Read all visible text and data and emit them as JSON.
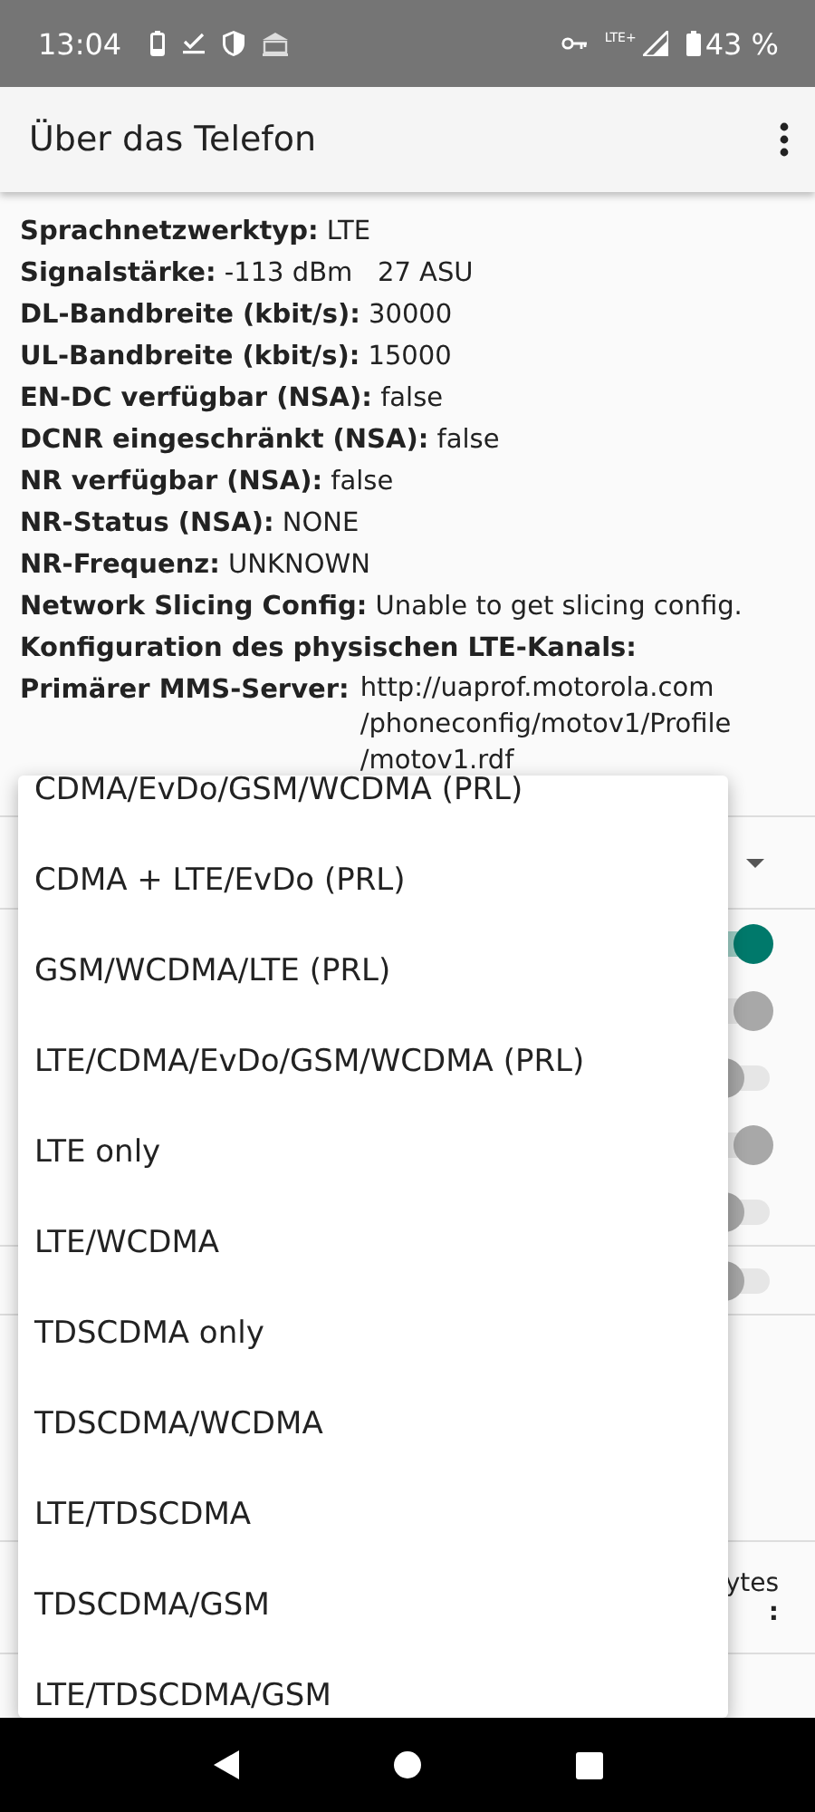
{
  "status_bar": {
    "time": "13:04",
    "network": "LTE+",
    "battery": "43 %"
  },
  "app_bar": {
    "title": "Über das Telefon"
  },
  "info": [
    {
      "label": "Sprachnetzwerktyp:",
      "value": "LTE"
    },
    {
      "label": "Signalstärke:",
      "value": "-113 dBm   27 ASU"
    },
    {
      "label": "DL-Bandbreite (kbit/s):",
      "value": "30000"
    },
    {
      "label": "UL-Bandbreite (kbit/s):",
      "value": "15000"
    },
    {
      "label": "EN-DC verfügbar (NSA):",
      "value": "false"
    },
    {
      "label": "DCNR eingeschränkt (NSA):",
      "value": "false"
    },
    {
      "label": "NR verfügbar (NSA):",
      "value": "false"
    },
    {
      "label": "NR-Status (NSA):",
      "value": "NONE"
    },
    {
      "label": "NR-Frequenz:",
      "value": "UNKNOWN"
    },
    {
      "label": "Network Slicing Config:",
      "value": "Unable to get slicing config."
    },
    {
      "label": "Konfiguration des physischen LTE-Kanals:"
    },
    {
      "label": "Primärer MMS-Server:",
      "value_lines": [
        "http://uaprof.motorola.com",
        "/phoneconfig/motov1/Profile",
        "/motov1.rdf"
      ]
    }
  ],
  "settings_groups": [
    {
      "rows": [
        {
          "kind": "dropdown"
        }
      ]
    },
    {
      "rows": [
        {
          "kind": "toggle",
          "on": true,
          "disabled": false
        },
        {
          "kind": "toggle",
          "on": true,
          "disabled": true
        },
        {
          "kind": "toggle",
          "on": false,
          "disabled": true
        },
        {
          "kind": "toggle",
          "on": true,
          "disabled": true
        },
        {
          "kind": "toggle",
          "on": false,
          "disabled": true
        }
      ]
    },
    {
      "rows": [
        {
          "kind": "toggle",
          "on": false,
          "disabled": true
        }
      ]
    },
    {
      "rows": [
        {
          "kind": "text",
          "lines": [
            "ytes",
            ":"
          ]
        }
      ]
    }
  ],
  "menu": {
    "items": [
      {
        "label": "CDMA/EvDo/GSM/WCDMA (PRL)"
      },
      {
        "label": "CDMA + LTE/EvDo (PRL)"
      },
      {
        "label": "GSM/WCDMA/LTE (PRL)"
      },
      {
        "label": "LTE/CDMA/EvDo/GSM/WCDMA (PRL)"
      },
      {
        "label": "LTE only"
      },
      {
        "label": "LTE/WCDMA"
      },
      {
        "label": "TDSCDMA only"
      },
      {
        "label": "TDSCDMA/WCDMA"
      },
      {
        "label": "LTE/TDSCDMA"
      },
      {
        "label": "TDSCDMA/GSM"
      },
      {
        "label": "LTE/TDSCDMA/GSM"
      }
    ]
  }
}
